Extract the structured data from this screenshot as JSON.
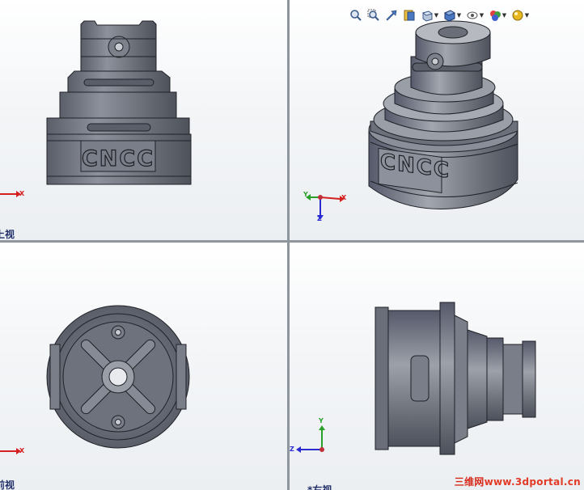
{
  "viewports": {
    "front": {
      "label": "上视",
      "axes": {
        "h": "X"
      },
      "engraving": "CNCC"
    },
    "isometric": {
      "axes": {
        "x": "X",
        "y": "Y",
        "z": "Z"
      },
      "engraving": "CNCC"
    },
    "top": {
      "label": "前视",
      "axes": {
        "h": "X"
      }
    },
    "right": {
      "label": "*右视",
      "axes": {
        "y": "Y",
        "z": "Z"
      }
    }
  },
  "toolbar": {
    "items": [
      {
        "name": "zoom-to-fit",
        "icon": "zoom-fit-icon"
      },
      {
        "name": "zoom-to-area",
        "icon": "zoom-area-icon"
      },
      {
        "name": "previous-view",
        "icon": "previous-view-icon"
      },
      {
        "name": "section-view",
        "icon": "section-view-icon"
      },
      {
        "name": "view-orientation",
        "icon": "view-orientation-icon"
      },
      {
        "name": "display-style",
        "icon": "display-style-icon"
      },
      {
        "name": "hide-show-items",
        "icon": "hide-show-icon"
      },
      {
        "name": "edit-appearance",
        "icon": "appearance-icon"
      },
      {
        "name": "apply-scene",
        "icon": "scene-icon"
      }
    ]
  },
  "watermark": {
    "cn": "三维网",
    "url": "www.3dportal.cn"
  },
  "colors": {
    "part": "#6a6e78",
    "edge": "#202228",
    "x_axis": "#d42020",
    "y_axis": "#2aa02a",
    "z_axis": "#2a2ad0"
  }
}
